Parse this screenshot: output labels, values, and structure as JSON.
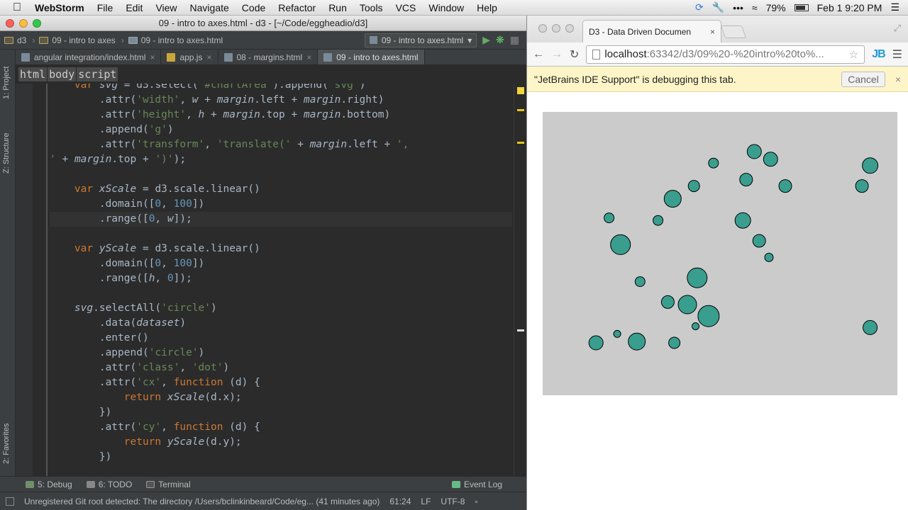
{
  "menubar": {
    "apple": "",
    "app": "WebStorm",
    "items": [
      "File",
      "Edit",
      "View",
      "Navigate",
      "Code",
      "Refactor",
      "Run",
      "Tools",
      "VCS",
      "Window",
      "Help"
    ],
    "battery": "79%",
    "clock": "Feb 1  9:20 PM"
  },
  "ide": {
    "title": "09 - intro to axes.html - d3 - [~/Code/eggheadio/d3]",
    "nav": {
      "crumb1": "d3",
      "crumb2": "09 - intro to axes",
      "crumb3": "09 - intro to axes.html",
      "run_config": "09 - intro to axes.html"
    },
    "side_tabs": {
      "project": "1: Project",
      "structure": "Z: Structure",
      "favorites": "2: Favorites"
    },
    "tabs": [
      {
        "label": "angular integration/index.html"
      },
      {
        "label": "app.js"
      },
      {
        "label": "08 - margins.html"
      },
      {
        "label": "09 - intro to axes.html"
      }
    ],
    "breadcrumbs": [
      "html",
      "body",
      "script"
    ],
    "tools": {
      "debug": "5: Debug",
      "todo": "6: TODO",
      "terminal": "Terminal",
      "event_log": "Event Log"
    },
    "status": {
      "message": "Unregistered Git root detected: The directory /Users/bclinkinbeard/Code/eg... (41 minutes ago)",
      "position": "61:24",
      "line_sep": "LF",
      "encoding": "UTF-8"
    }
  },
  "browser": {
    "tab_title": "D3 - Data Driven Documen",
    "url_host": "localhost",
    "url_rest": ":63342/d3/09%20-%20intro%20to%...",
    "jb": "JB",
    "debug_msg": "\"JetBrains IDE Support\" is debugging this tab.",
    "cancel": "Cancel",
    "circle_fill": "#3a9e8f"
  },
  "chart_data": {
    "type": "scatter",
    "xlim": [
      0,
      100
    ],
    "ylim": [
      0,
      100
    ],
    "points": [
      {
        "x": 60.5,
        "y": 90,
        "r": 10
      },
      {
        "x": 65.5,
        "y": 87,
        "r": 10
      },
      {
        "x": 48,
        "y": 85.5,
        "r": 7
      },
      {
        "x": 96,
        "y": 84.5,
        "r": 11
      },
      {
        "x": 58,
        "y": 79,
        "r": 9
      },
      {
        "x": 42,
        "y": 76.5,
        "r": 8
      },
      {
        "x": 70,
        "y": 76.5,
        "r": 9
      },
      {
        "x": 93.5,
        "y": 76.5,
        "r": 9
      },
      {
        "x": 35.5,
        "y": 71.5,
        "r": 12
      },
      {
        "x": 16,
        "y": 64,
        "r": 7
      },
      {
        "x": 31,
        "y": 63,
        "r": 7
      },
      {
        "x": 57,
        "y": 63,
        "r": 11
      },
      {
        "x": 62,
        "y": 55,
        "r": 9
      },
      {
        "x": 19.5,
        "y": 53.5,
        "r": 14
      },
      {
        "x": 65,
        "y": 48.5,
        "r": 6
      },
      {
        "x": 43,
        "y": 40.5,
        "r": 14
      },
      {
        "x": 25.5,
        "y": 39,
        "r": 7
      },
      {
        "x": 34,
        "y": 31,
        "r": 9
      },
      {
        "x": 40,
        "y": 30,
        "r": 13
      },
      {
        "x": 46.5,
        "y": 25.5,
        "r": 15
      },
      {
        "x": 42.5,
        "y": 21.5,
        "r": 5
      },
      {
        "x": 96,
        "y": 21,
        "r": 10
      },
      {
        "x": 18.5,
        "y": 18.5,
        "r": 5
      },
      {
        "x": 24.5,
        "y": 15.5,
        "r": 12
      },
      {
        "x": 12,
        "y": 15,
        "r": 10
      },
      {
        "x": 36,
        "y": 15,
        "r": 8
      }
    ]
  }
}
